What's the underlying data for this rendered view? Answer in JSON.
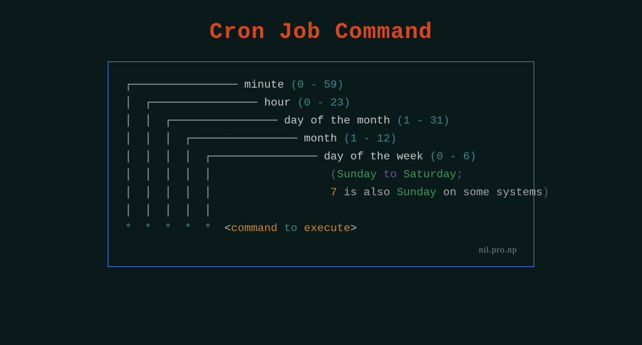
{
  "title": "Cron Job Command",
  "fields": {
    "minute": {
      "label": "minute",
      "range": "(0 - 59)"
    },
    "hour": {
      "label": "hour",
      "range": "(0 - 23)"
    },
    "dom": {
      "label": "day of the month",
      "range": "(1 - 31)"
    },
    "month": {
      "label": "month",
      "range": "(1 - 12)"
    },
    "dow": {
      "label": "day of the week",
      "range": "(0 - 6)"
    }
  },
  "note": {
    "open": "(",
    "sunday": "Sunday",
    "to": " to ",
    "saturday": "Saturday",
    "semi": ";",
    "seven": "7",
    "also": " is also ",
    "sunday2": "Sunday",
    "tail": " on some systems",
    "close": ")"
  },
  "stars": "*  *  *  *  *",
  "command": {
    "lt": "<",
    "cmd": "command",
    "to": " to ",
    "exec": "execute",
    "gt": ">"
  },
  "credit": "nil.pro.np"
}
